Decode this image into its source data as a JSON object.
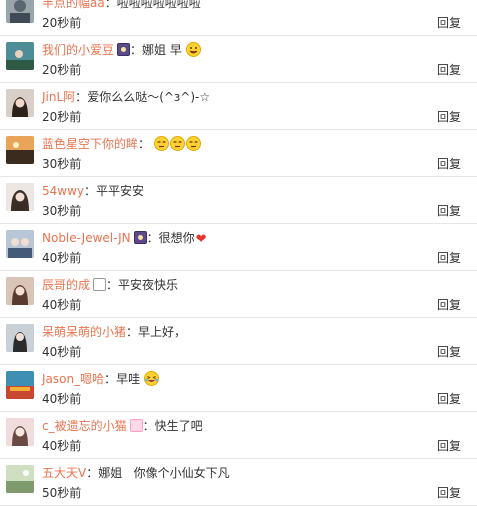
{
  "reply_label": "回复",
  "comments": [
    {
      "username": "半点的幅aa",
      "colon": "：",
      "text": "啦啦啦啦啦啦啦",
      "time": "20秒前",
      "avatar_color": "#6b7a86"
    },
    {
      "username": "我们的小爱豆",
      "badge": "night-badge-icon",
      "colon": "：",
      "text": "娜姐 早",
      "emoji": "smile-emoji-icon",
      "time": "20秒前",
      "avatar_color": "#3d6f7c"
    },
    {
      "username": "JinL阿",
      "colon": "：",
      "text": "爱你么么哒～(^з^)-☆",
      "time": "20秒前",
      "avatar_color": "#8a6a60"
    },
    {
      "username": "蓝色星空下你的眸",
      "colon": "：",
      "text": "",
      "emoji": "smirk-emoji-icon",
      "emoji_count": 3,
      "time": "30秒前",
      "avatar_color": "#5b4a3a"
    },
    {
      "username": "54wwy",
      "colon": "：",
      "text": "平平安安",
      "time": "30秒前",
      "avatar_color": "#b9b2aa"
    },
    {
      "username": "Noble-Jewel-JN",
      "badge": "night-badge-icon",
      "colon": "：",
      "text": "很想你",
      "emoji": "heart-icon",
      "time": "40秒前",
      "avatar_color": "#7a8fa8"
    },
    {
      "username": "辰哥的成",
      "badge": "panda-badge-icon",
      "colon": "：",
      "text": "平安夜快乐",
      "time": "40秒前",
      "avatar_color": "#a57c6c"
    },
    {
      "username": "呆萌呆萌的小猪",
      "colon": "：",
      "text": "早上好，",
      "time": "40秒前",
      "avatar_color": "#7d8790"
    },
    {
      "username": "Jason_嗯哈",
      "colon": "：",
      "text": "早哇",
      "emoji": "laugh-cry-emoji-icon",
      "time": "40秒前",
      "avatar_color": "#c7462f"
    },
    {
      "username": "c_被遗忘的小猫",
      "badge": "crown-badge-icon",
      "colon": "：",
      "text": "快生了吧",
      "time": "40秒前",
      "avatar_color": "#c9a6a4"
    },
    {
      "username": "五大天V",
      "colon": "：",
      "text": "娜姐   你像个小仙女下凡",
      "time": "50秒前",
      "avatar_color": "#9fb88e"
    }
  ]
}
